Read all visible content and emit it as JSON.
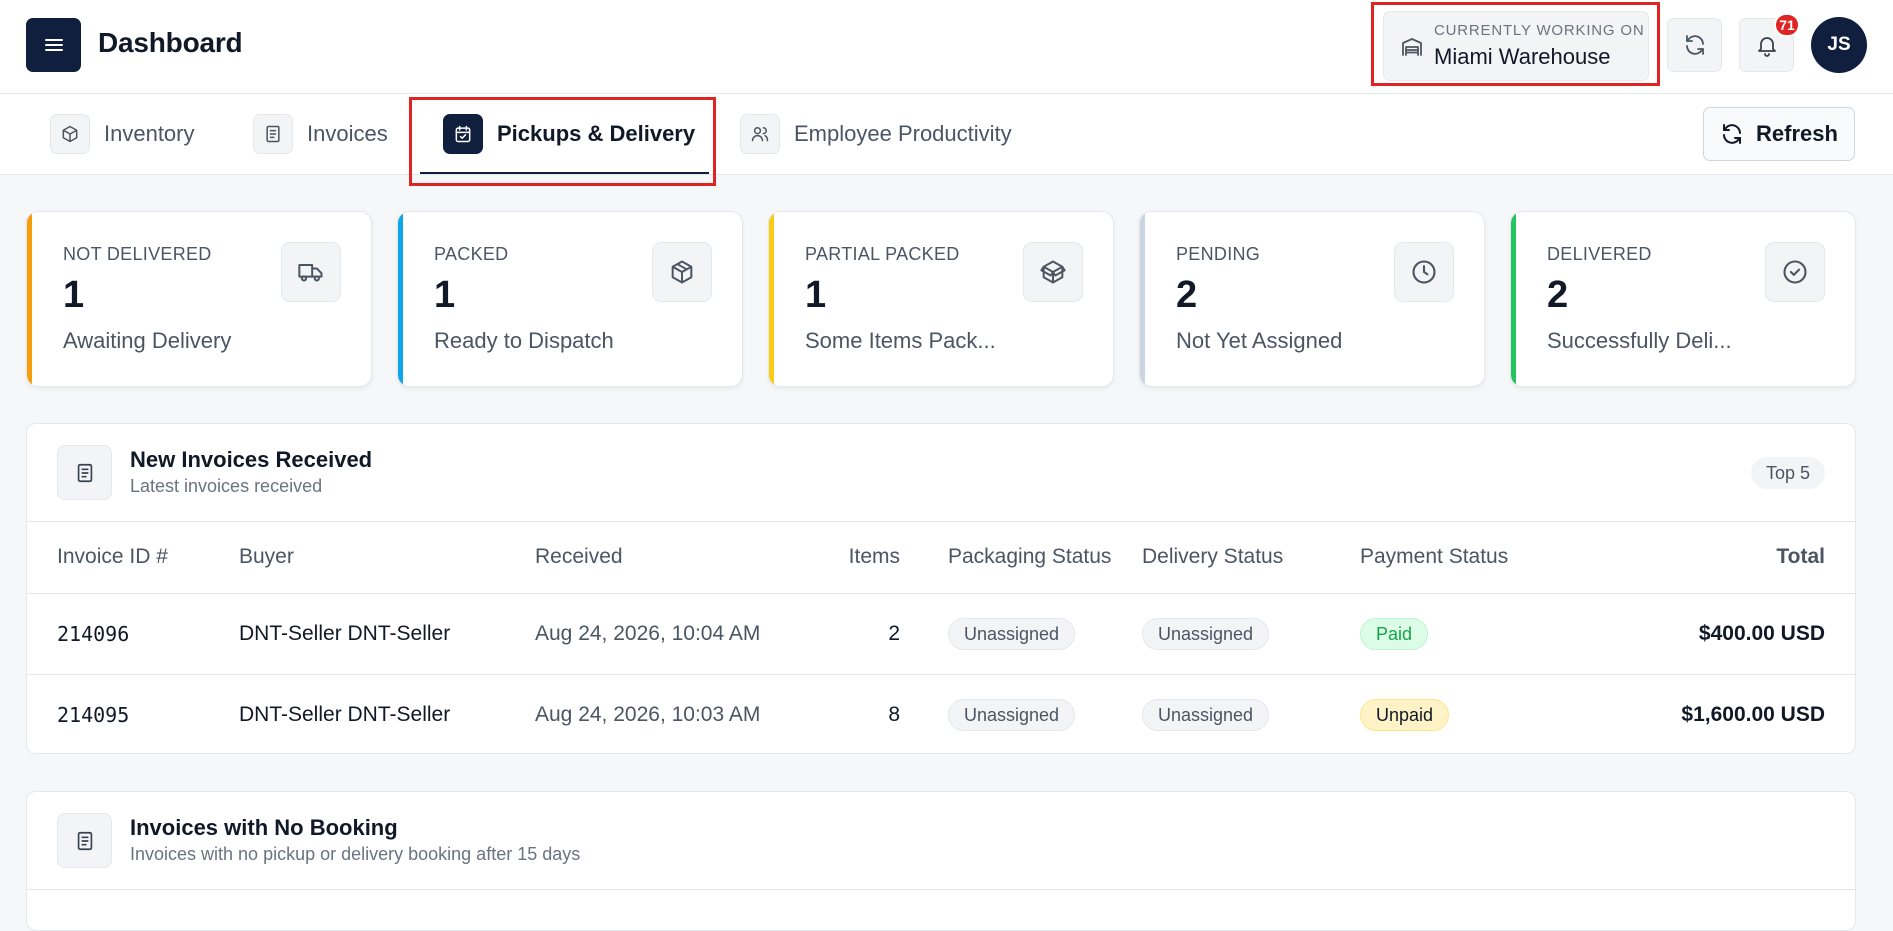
{
  "header": {
    "title": "Dashboard",
    "location_caption": "CURRENTLY WORKING ON",
    "location_name": "Miami Warehouse",
    "notification_count": "71",
    "avatar_initials": "JS"
  },
  "tabs": [
    {
      "label": "Inventory",
      "icon": "box-icon",
      "active": false
    },
    {
      "label": "Invoices",
      "icon": "document-icon",
      "active": false
    },
    {
      "label": "Pickups & Delivery",
      "icon": "calendar-check-icon",
      "active": true
    },
    {
      "label": "Employee Productivity",
      "icon": "users-icon",
      "active": false
    }
  ],
  "refresh_label": "Refresh",
  "stats": [
    {
      "label": "NOT DELIVERED",
      "value": "1",
      "sub": "Awaiting Delivery",
      "color": "#f59e0b",
      "icon": "truck-icon"
    },
    {
      "label": "PACKED",
      "value": "1",
      "sub": "Ready to Dispatch",
      "color": "#0ea5e9",
      "icon": "package-icon"
    },
    {
      "label": "PARTIAL PACKED",
      "value": "1",
      "sub": "Some Items Pack...",
      "color": "#facc15",
      "icon": "package-open-icon"
    },
    {
      "label": "PENDING",
      "value": "2",
      "sub": "Not Yet Assigned",
      "color": "#cbd5e1",
      "icon": "clock-icon"
    },
    {
      "label": "DELIVERED",
      "value": "2",
      "sub": "Successfully Deli...",
      "color": "#22c55e",
      "icon": "check-circle-icon"
    }
  ],
  "new_invoices": {
    "title": "New Invoices Received",
    "subtitle": "Latest invoices received",
    "badge": "Top 5",
    "columns": [
      "Invoice ID #",
      "Buyer",
      "Received",
      "Items",
      "Packaging Status",
      "Delivery Status",
      "Payment Status",
      "Total"
    ],
    "rows": [
      {
        "id": "214096",
        "buyer": "DNT-Seller DNT-Seller",
        "received": "Aug 24, 2026, 10:04 AM",
        "items": "2",
        "packaging": "Unassigned",
        "delivery": "Unassigned",
        "payment": "Paid",
        "total": "$400.00 USD"
      },
      {
        "id": "214095",
        "buyer": "DNT-Seller DNT-Seller",
        "received": "Aug 24, 2026, 10:03 AM",
        "items": "8",
        "packaging": "Unassigned",
        "delivery": "Unassigned",
        "payment": "Unpaid",
        "total": "$1,600.00 USD"
      }
    ]
  },
  "no_booking": {
    "title": "Invoices with No Booking",
    "subtitle": "Invoices with no pickup or delivery booking after 15 days"
  },
  "colors": {
    "navy": "#0f1f3d",
    "highlight": "#e02424",
    "paid_green": "#16a34a",
    "unpaid_amber": "#fef3c7"
  }
}
